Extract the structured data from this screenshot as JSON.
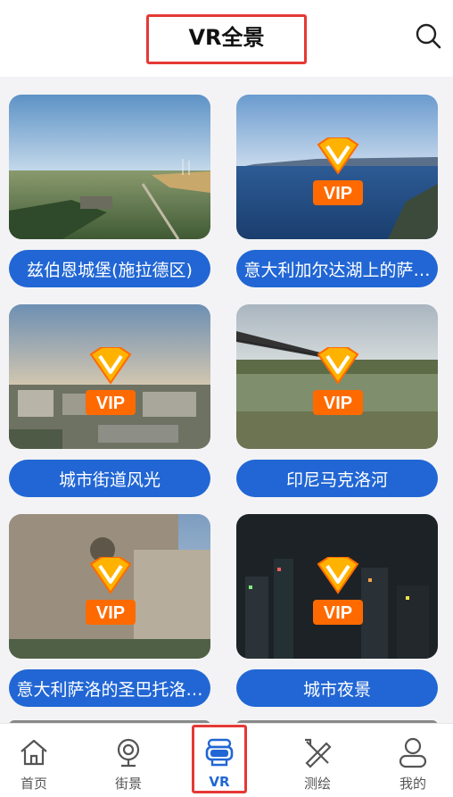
{
  "header": {
    "title": "VR全景",
    "search_icon": "search-icon"
  },
  "cards": [
    {
      "label": "兹伯恩城堡(施拉德区)",
      "vip": false
    },
    {
      "label": "意大利加尔达湖上的萨…",
      "vip": true,
      "badge_text": "VIP"
    },
    {
      "label": "城市街道风光",
      "vip": true,
      "badge_text": "VIP"
    },
    {
      "label": "印尼马克洛河",
      "vip": true,
      "badge_text": "VIP"
    },
    {
      "label": "意大利萨洛的圣巴托洛…",
      "vip": true,
      "badge_text": "VIP"
    },
    {
      "label": "城市夜景",
      "vip": true,
      "badge_text": "VIP"
    }
  ],
  "tabbar": {
    "items": [
      {
        "label": "首页",
        "icon": "home-icon"
      },
      {
        "label": "街景",
        "icon": "camera-icon"
      },
      {
        "label": "VR",
        "icon": "vr-headset-icon",
        "active": true
      },
      {
        "label": "测绘",
        "icon": "ruler-pencil-icon"
      },
      {
        "label": "我的",
        "icon": "user-icon"
      }
    ]
  },
  "colors": {
    "accent": "#2166d4",
    "highlight": "#e53935",
    "vip_orange": "#ff6a00",
    "vip_gold": "#ffb300"
  }
}
